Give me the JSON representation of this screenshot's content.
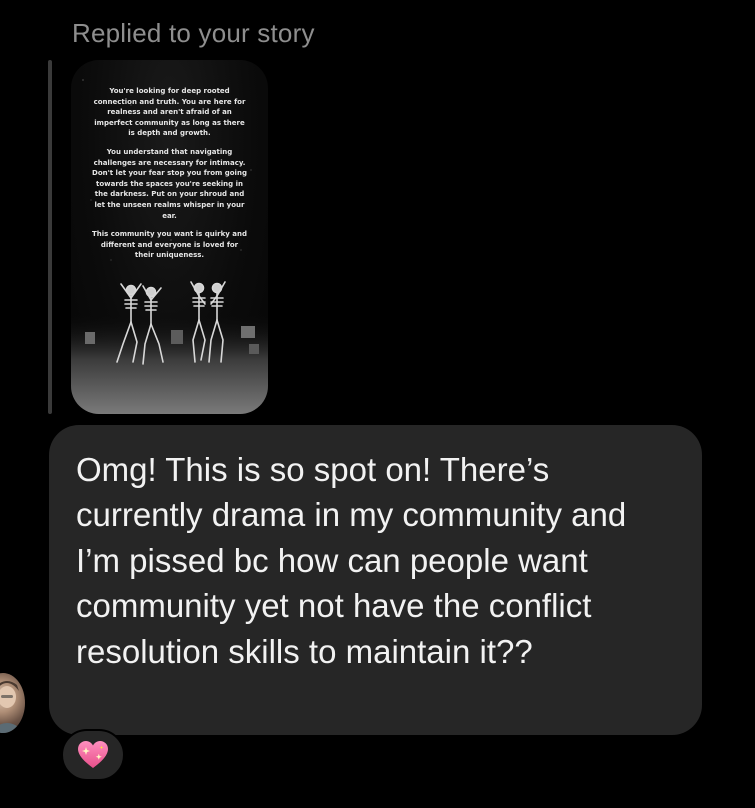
{
  "header": {
    "reply_label": "Replied to your story"
  },
  "story": {
    "paragraphs": [
      "You're looking for deep rooted\nconnection and truth. You are here for\nrealness and aren't afraid of an\nimperfect community as long as there\nis depth and growth.",
      "You understand that navigating\nchallenges are necessary for intimacy.\nDon't let your fear stop you from going\ntowards the spaces you're seeking in\nthe darkness. Put on your shroud and\nlet the unseen realms whisper in your\near.",
      "This community you want is quirky and\ndifferent and everyone is loved for\ntheir uniqueness."
    ],
    "image_icon": "dancing-skeletons-graveyard"
  },
  "message": {
    "text": "Omg! This is so spot on! There’s currently drama in my community and I’m pissed bc how can people want community yet not have the conflict resolution skills to maintain it??"
  },
  "reaction": {
    "icon": "sparkling-heart-icon"
  },
  "colors": {
    "background": "#000000",
    "bubble": "#262626",
    "muted_text": "#8e8e8e",
    "quote_bar": "#3a3a3a",
    "heart": "#f06a9e"
  }
}
